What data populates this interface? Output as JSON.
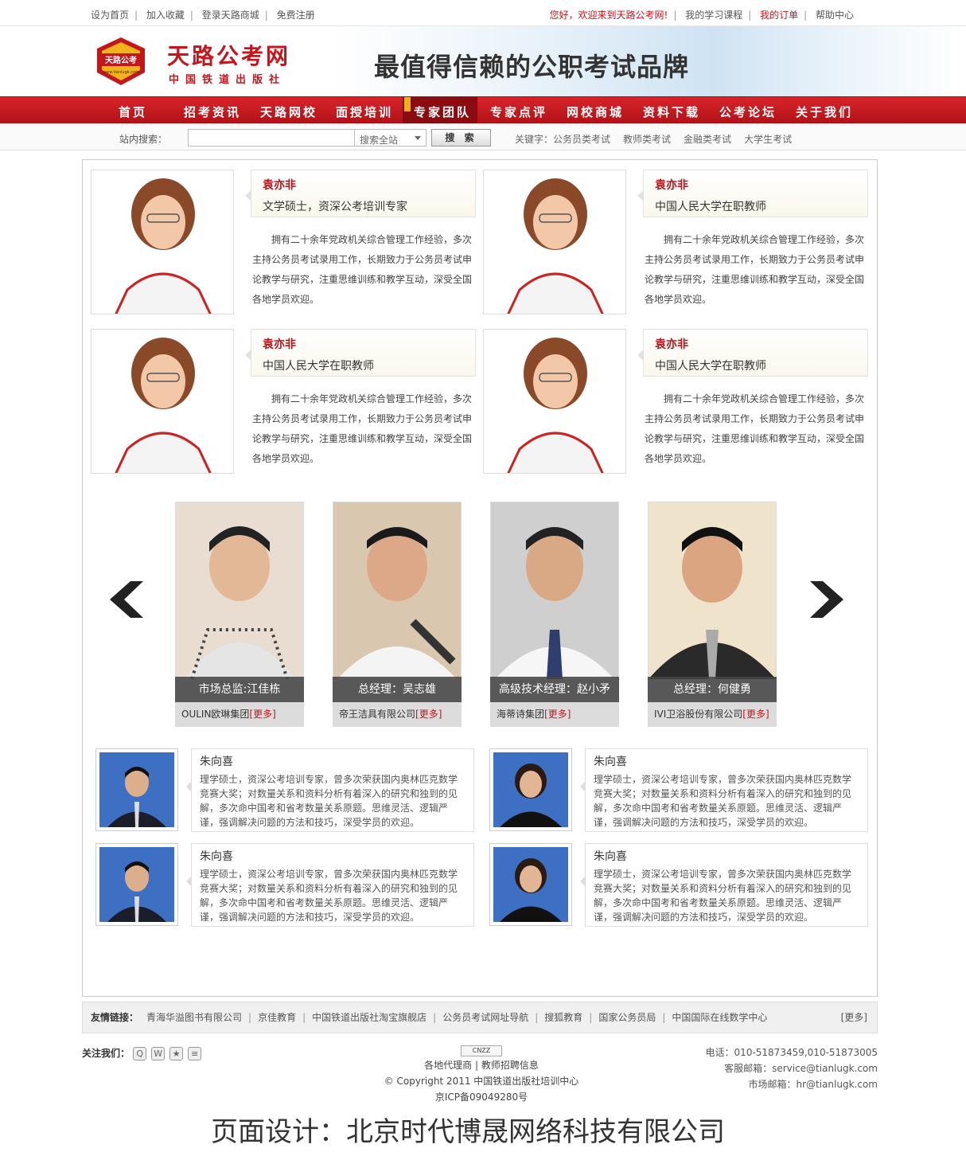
{
  "topbar": {
    "left_links": [
      "设为首页",
      "加入收藏",
      "登录天路商城",
      "免费注册"
    ],
    "welcome": "您好，欢迎来到天路公考网!",
    "right_links": [
      "我的学习课程",
      "我的订单",
      "帮助中心"
    ]
  },
  "header": {
    "logo_badge": "天路公考",
    "logo_url": "www.tianlugk.com",
    "logo_title": "天路公考网",
    "logo_sub": "中国铁道出版社",
    "slogan": "最值得信赖的公职考试品牌"
  },
  "nav": {
    "items": [
      "首页",
      "招考资讯",
      "天路网校",
      "面授培训",
      "专家团队",
      "专家点评",
      "网校商城",
      "资料下载",
      "公考论坛",
      "关于我们"
    ],
    "active": "专家团队"
  },
  "search": {
    "label": "站内搜索：",
    "value": "",
    "scope": "搜索全站",
    "button": "搜 索",
    "keywords_label": "关键字：",
    "keywords": [
      "公务员类考试",
      "教师类考试",
      "金融类考试",
      "大学生考试"
    ]
  },
  "experts": [
    {
      "name": "袁亦非",
      "title": "文学硕士，资深公考培训专家",
      "desc": "拥有二十余年党政机关综合管理工作经验，多次主持公务员考试录用工作，长期致力于公务员考试申论教学与研究，注重思维训练和教学互动，深受全国各地学员欢迎。"
    },
    {
      "name": "袁亦非",
      "title": "中国人民大学在职教师",
      "desc": "拥有二十余年党政机关综合管理工作经验，多次主持公务员考试录用工作，长期致力于公务员考试申论教学与研究，注重思维训练和教学互动，深受全国各地学员欢迎。"
    },
    {
      "name": "袁亦非",
      "title": "中国人民大学在职教师",
      "desc": "拥有二十余年党政机关综合管理工作经验，多次主持公务员考试录用工作，长期致力于公务员考试申论教学与研究，注重思维训练和教学互动，深受全国各地学员欢迎。"
    },
    {
      "name": "袁亦非",
      "title": "中国人民大学在职教师",
      "desc": "拥有二十余年党政机关综合管理工作经验，多次主持公务员考试录用工作，长期致力于公务员考试申论教学与研究，注重思维训练和教学互动，深受全国各地学员欢迎。"
    }
  ],
  "carousel": [
    {
      "caption": "市场总监:江佳栋",
      "company": "OULIN欧琳集团",
      "more": "[更多]"
    },
    {
      "caption": "总经理：吴志雄",
      "company": "帝王洁具有限公司",
      "more": "[更多]"
    },
    {
      "caption": "高级技术经理：赵小矛",
      "company": "海蒂诗集团",
      "more": "[更多]"
    },
    {
      "caption": "总经理：何健勇",
      "company": "IVI卫浴股份有限公司",
      "more": "[更多]"
    }
  ],
  "teachers": [
    {
      "name": "朱向喜",
      "desc": "理学硕士，资深公考培训专家，曾多次荣获国内奥林匹克数学竞赛大奖；对数量关系和资料分析有着深入的研究和独到的见解，多次命中国考和省考数量关系原题。思维灵活、逻辑严谨，强调解决问题的方法和技巧，深受学员的欢迎。"
    },
    {
      "name": "朱向喜",
      "desc": "理学硕士，资深公考培训专家，曾多次荣获国内奥林匹克数学竞赛大奖；对数量关系和资料分析有着深入的研究和独到的见解，多次命中国考和省考数量关系原题。思维灵活、逻辑严谨，强调解决问题的方法和技巧，深受学员的欢迎。"
    },
    {
      "name": "朱向喜",
      "desc": "理学硕士，资深公考培训专家，曾多次荣获国内奥林匹克数学竞赛大奖；对数量关系和资料分析有着深入的研究和独到的见解，多次命中国考和省考数量关系原题。思维灵活、逻辑严谨，强调解决问题的方法和技巧，深受学员的欢迎。"
    },
    {
      "name": "朱向喜",
      "desc": "理学硕士，资深公考培训专家，曾多次荣获国内奥林匹克数学竞赛大奖；对数量关系和资料分析有着深入的研究和独到的见解，多次命中国考和省考数量关系原题。思维灵活、逻辑严谨，强调解决问题的方法和技巧，深受学员的欢迎。"
    }
  ],
  "friends": {
    "label": "友情链接：",
    "links": [
      "青海华溢图书有限公司",
      "京佳教育",
      "中国铁道出版社淘宝旗舰店",
      "公务员考试网址导航",
      "搜狐教育",
      "国家公务员局",
      "中国国际在线数学中心"
    ],
    "more": "[更多]"
  },
  "footer": {
    "follow_label": "关注我们：",
    "badge": "CNZZ",
    "center_links": [
      "各地代理商",
      "教师招聘信息"
    ],
    "copyright": "© Copyright 2011 中国铁道出版社培训中心",
    "icp": "京ICP备09049280号",
    "phone": "电话：010-51873459,010-51873005",
    "service_mail": "客服邮箱：service@tianlugk.com",
    "market_mail": "市场邮箱：hr@tianlugk.com"
  },
  "design_credit": "页面设计：北京时代博晟网络科技有限公司"
}
